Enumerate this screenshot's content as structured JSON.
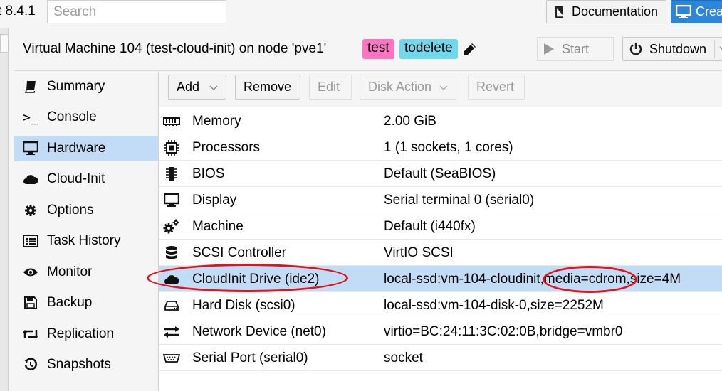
{
  "topbar": {
    "version": "t 8.4.1",
    "search_placeholder": "Search",
    "documentation_label": "Documentation",
    "create_label": "Crea"
  },
  "vm": {
    "title": "Virtual Machine 104 (test-cloud-init) on node 'pve1'",
    "tags": [
      "test",
      "todelete"
    ],
    "tag_colors": {
      "test": "#ff73c3",
      "todelete": "#6fd8ec"
    },
    "start_label": "Start",
    "shutdown_label": "Shutdown"
  },
  "sidebar": {
    "items": [
      {
        "label": "Summary",
        "icon": "book-icon"
      },
      {
        "label": "Console",
        "icon": "terminal-icon"
      },
      {
        "label": "Hardware",
        "icon": "desktop-icon",
        "active": true
      },
      {
        "label": "Cloud-Init",
        "icon": "cloud-icon"
      },
      {
        "label": "Options",
        "icon": "gear-icon"
      },
      {
        "label": "Task History",
        "icon": "list-icon"
      },
      {
        "label": "Monitor",
        "icon": "eye-icon"
      },
      {
        "label": "Backup",
        "icon": "floppy-icon"
      },
      {
        "label": "Replication",
        "icon": "retweet-icon"
      },
      {
        "label": "Snapshots",
        "icon": "history-icon"
      }
    ]
  },
  "toolbar": {
    "add": "Add",
    "remove": "Remove",
    "edit": "Edit",
    "disk_action": "Disk Action",
    "revert": "Revert"
  },
  "hardware": {
    "rows": [
      {
        "name": "Memory",
        "value": "2.00 GiB",
        "icon": "memory-icon"
      },
      {
        "name": "Processors",
        "value": "1 (1 sockets, 1 cores)",
        "icon": "cpu-icon"
      },
      {
        "name": "BIOS",
        "value": "Default (SeaBIOS)",
        "icon": "microchip-icon"
      },
      {
        "name": "Display",
        "value": "Serial terminal 0 (serial0)",
        "icon": "desktop-icon"
      },
      {
        "name": "Machine",
        "value": "Default (i440fx)",
        "icon": "cogs-icon"
      },
      {
        "name": "SCSI Controller",
        "value": "VirtIO SCSI",
        "icon": "database-icon"
      },
      {
        "name": "CloudInit Drive (ide2)",
        "value": "local-ssd:vm-104-cloudinit,media=cdrom,size=4M",
        "icon": "cloud-icon",
        "selected": true
      },
      {
        "name": "Hard Disk (scsi0)",
        "value": "local-ssd:vm-104-disk-0,size=2252M",
        "icon": "hdd-icon"
      },
      {
        "name": "Network Device (net0)",
        "value": "virtio=BC:24:11:3C:02:0B,bridge=vmbr0",
        "icon": "exchange-icon"
      },
      {
        "name": "Serial Port (serial0)",
        "value": "socket",
        "icon": "serial-port-icon"
      }
    ]
  },
  "annotation_color": "#e0141b",
  "selection_color": "#c2dcf5"
}
